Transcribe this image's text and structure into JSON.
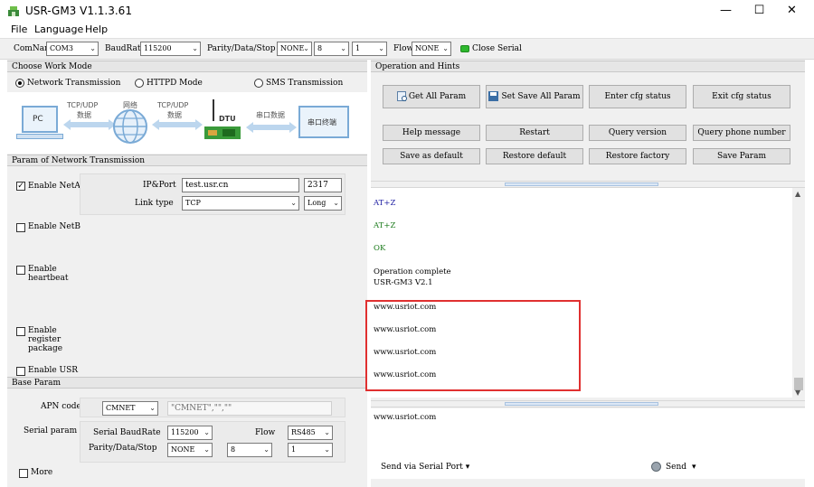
{
  "window": {
    "title": "USR-GM3 V1.1.3.61",
    "minimize_glyph": "—",
    "maximize_glyph": "☐",
    "close_glyph": "✕"
  },
  "menu": [
    "File",
    "Language",
    "Help"
  ],
  "toolbar": {
    "comname_label": "ComName",
    "comname_value": "COM3",
    "baudrate_label": "BaudRate",
    "baudrate_value": "115200",
    "parity_label": "Parity/Data/Stop",
    "parity_value": "NONE",
    "data_value": "8",
    "stop_value": "1",
    "flow_label": "Flow",
    "flow_value": "NONE",
    "close_serial_label": "Close Serial",
    "status_color": "#2eb82e"
  },
  "work_mode": {
    "header": "Choose Work Mode",
    "options": [
      "Network Transmission",
      "HTTPD Mode",
      "SMS Transmission"
    ],
    "selected_index": 0
  },
  "diagram": {
    "pc_label": "PC",
    "arrow1_top": "TCP/UDP",
    "arrow1_bottom": "数据",
    "cloud_label": "网络",
    "arrow2_top": "TCP/UDP",
    "arrow2_bottom": "数据",
    "dtu_label": "DTU",
    "serial_data_label": "串口数据",
    "terminal_label": "串口终端"
  },
  "network_params": {
    "header": "Param of Network Transmission",
    "neta_label": "Enable NetA",
    "neta_checked": "✓",
    "ip_label": "IP&Port",
    "ip_value": "test.usr.cn",
    "port_value": "2317",
    "link_label": "Link type",
    "link_value": "TCP",
    "link_mode": "Long",
    "netb_label": "Enable NetB",
    "heartbeat_label_1": "Enable",
    "heartbeat_label_2": "heartbeat",
    "register_label_1": "Enable",
    "register_label_2": "register",
    "register_label_3": "package",
    "usr_label": "Enable USR"
  },
  "base_params": {
    "header": "Base Param",
    "apn_label": "APN code",
    "apn_value": "CMNET",
    "apn_string": "\"CMNET\",\"\",\"\"",
    "serial_label": "Serial param",
    "serial_baud_label": "Serial BaudRate",
    "serial_baud_value": "115200",
    "flow_label": "Flow",
    "flow_value": "RS485",
    "pds_label": "Parity/Data/Stop",
    "parity_value": "NONE",
    "data_value": "8",
    "stop_value": "1",
    "more_label": "More"
  },
  "operation": {
    "header": "Operation and Hints",
    "big_buttons": [
      "Get All Param",
      "Set Save All Param",
      "Enter cfg status",
      "Exit cfg status"
    ],
    "row2": [
      "Help message",
      "Restart",
      "Query version",
      "Query phone number"
    ],
    "row3": [
      "Save as default",
      "Restore default",
      "Restore factory",
      "Save Param"
    ]
  },
  "console": {
    "lines": [
      {
        "text": "AT+Z",
        "color": "#1a1aa0"
      },
      {
        "text": "AT+Z",
        "color": "#1a7a1a"
      },
      {
        "text": "OK",
        "color": "#1a7a1a"
      },
      {
        "text": "Operation complete",
        "color": "#000000"
      },
      {
        "text": "USR-GM3 V2.1",
        "color": "#000000"
      },
      {
        "text": "www.usriot.com",
        "color": "#000000"
      },
      {
        "text": "www.usriot.com",
        "color": "#000000"
      },
      {
        "text": "www.usriot.com",
        "color": "#000000"
      },
      {
        "text": "www.usriot.com",
        "color": "#000000"
      }
    ],
    "highlight_color": "#e03030"
  },
  "send_area": {
    "input_text": "www.usriot.com",
    "send_via_label": "Send via Serial Port",
    "send_label": "Send"
  }
}
